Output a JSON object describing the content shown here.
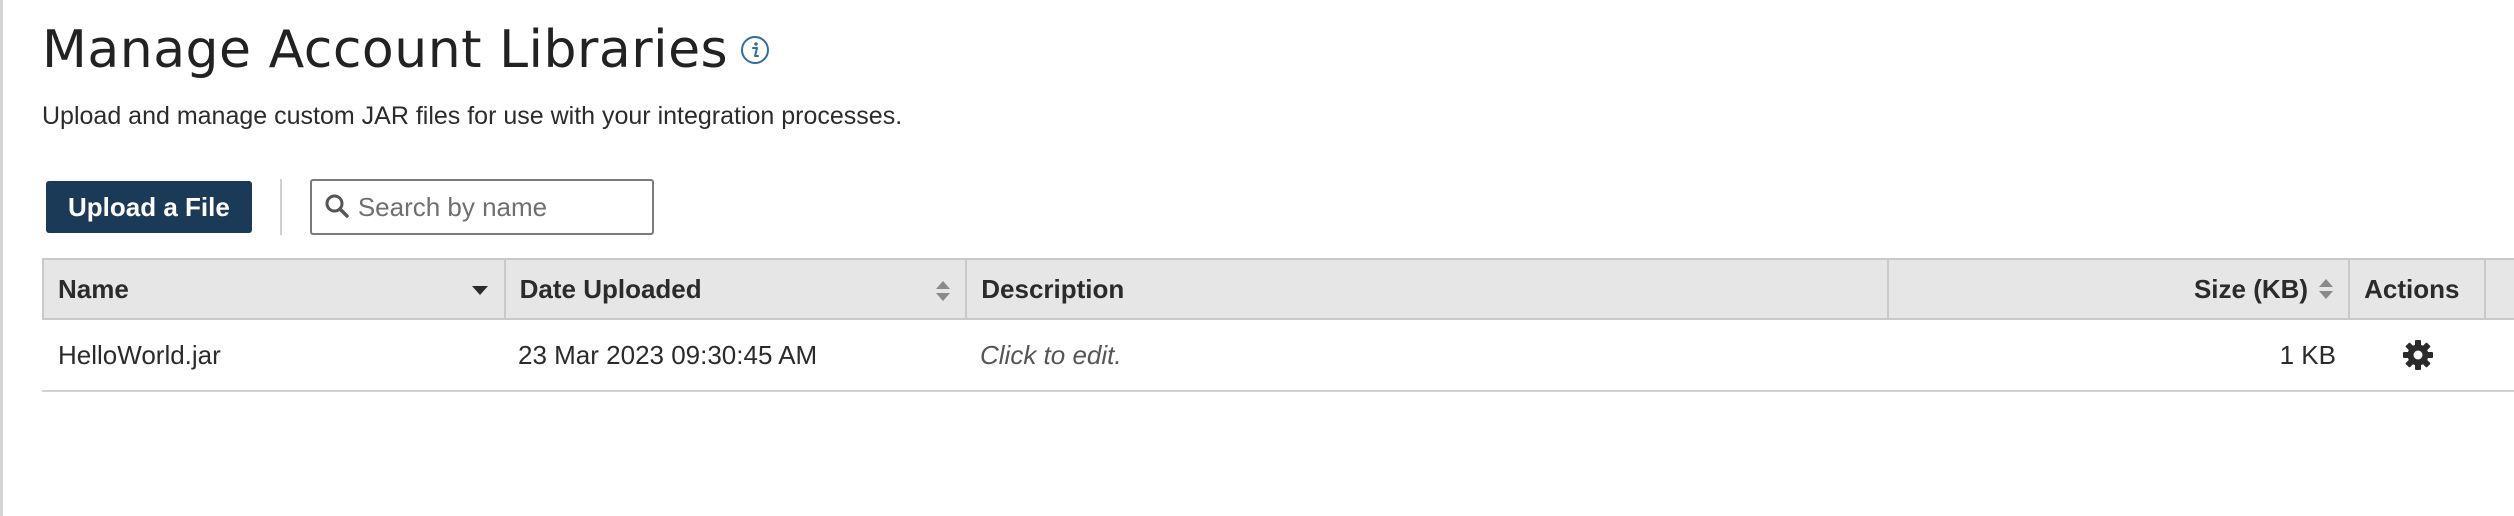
{
  "page": {
    "title": "Manage Account Libraries",
    "subtitle": "Upload and manage custom JAR files for use with your integration processes."
  },
  "toolbar": {
    "upload_label": "Upload a File",
    "search_placeholder": "Search by name",
    "search_value": ""
  },
  "table": {
    "columns": [
      {
        "label": "Name",
        "sort": "descending"
      },
      {
        "label": "Date Uploaded",
        "sort": "sortable"
      },
      {
        "label": "Description",
        "sort": "none"
      },
      {
        "label": "Size (KB)",
        "sort": "sortable"
      },
      {
        "label": "Actions",
        "sort": "none"
      }
    ],
    "rows": [
      {
        "name": "HelloWorld.jar",
        "date_uploaded": "23 Mar 2023 09:30:45 AM",
        "description": "Click to edit.",
        "size": "1 KB",
        "action_icon": "gear-icon"
      }
    ]
  },
  "colors": {
    "primary_button": "#1b3a57",
    "header_background": "#e6e6e6",
    "info_icon": "#2f6f9f"
  }
}
